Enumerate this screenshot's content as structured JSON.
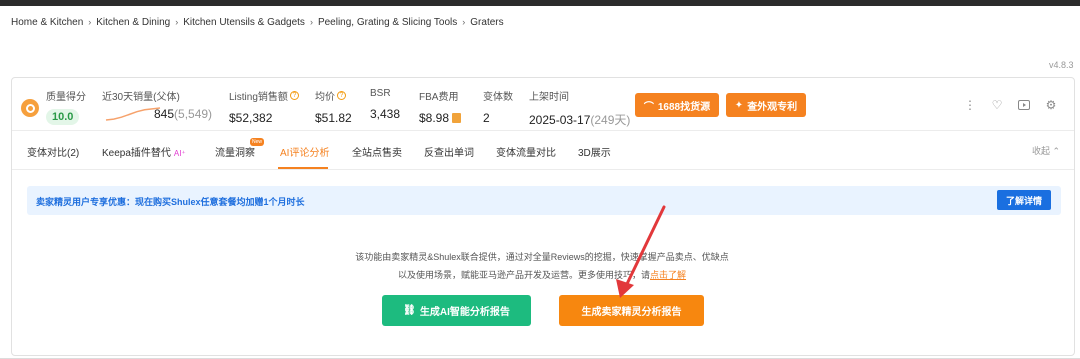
{
  "breadcrumb": [
    "Home & Kitchen",
    "Kitchen & Dining",
    "Kitchen Utensils & Gadgets",
    "Peeling, Grating & Slicing Tools",
    "Graters"
  ],
  "breadcrumb_separator": "›",
  "version": "v4.8.3",
  "stats": {
    "quality": {
      "label": "质量得分",
      "value": "10.0"
    },
    "sales30": {
      "label": "近30天销量(父体)",
      "value": "845",
      "parent_value": "(5,549)"
    },
    "listing_sales": {
      "label": "Listing销售额",
      "value": "$52,382"
    },
    "avg_price": {
      "label": "均价",
      "value": "$51.82"
    },
    "bsr": {
      "label": "BSR",
      "value": "3,438"
    },
    "fba": {
      "label": "FBA费用",
      "value": "$8.98"
    },
    "variants": {
      "label": "变体数",
      "value": "2"
    },
    "launch": {
      "label": "上架时间",
      "value": "2025-03-17",
      "days": "(249天)"
    }
  },
  "sparkline": [
    2,
    3,
    5,
    8,
    11,
    13,
    14,
    15
  ],
  "buttons": {
    "source_1688": "1688找货源",
    "patent": "查外观专利",
    "learn_more": "了解详情",
    "gen_ai_report": "生成AI智能分析报告",
    "gen_seller_report": "生成卖家精灵分析报告"
  },
  "tabs": [
    "变体对比(2)",
    "Keepa插件替代",
    "流量洞察",
    "AI评论分析",
    "全站点售卖",
    "反查出单词",
    "变体流量对比",
    "3D展示"
  ],
  "active_tab": "AI评论分析",
  "tab_ai_suffix": "AI⁺",
  "tab_new_badge": "New",
  "collapse_label": "收起",
  "promo_text": "卖家精灵用户专享优惠：现在购买Shulex任意套餐均加赠1个月时长",
  "description": {
    "line1": "该功能由卖家精灵&Shulex联合提供，通过对全量Reviews的挖掘，快速掌握产品卖点、优缺点",
    "line2": "以及使用场景，赋能亚马逊产品开发及运营。更多使用技巧，请",
    "link": "点击了解"
  },
  "colors": {
    "accent_orange": "#f58220",
    "promo_blue": "#1f6fde",
    "green_button": "#1dbb7f",
    "annotation_arrow": "#e2383b"
  },
  "icons": [
    "coin-logo-icon",
    "help-icon",
    "fba-icon",
    "alibaba-icon",
    "patent-icon",
    "more-icon",
    "heart-icon",
    "video-icon",
    "settings-icon",
    "link-icon",
    "chevron-up-icon"
  ]
}
